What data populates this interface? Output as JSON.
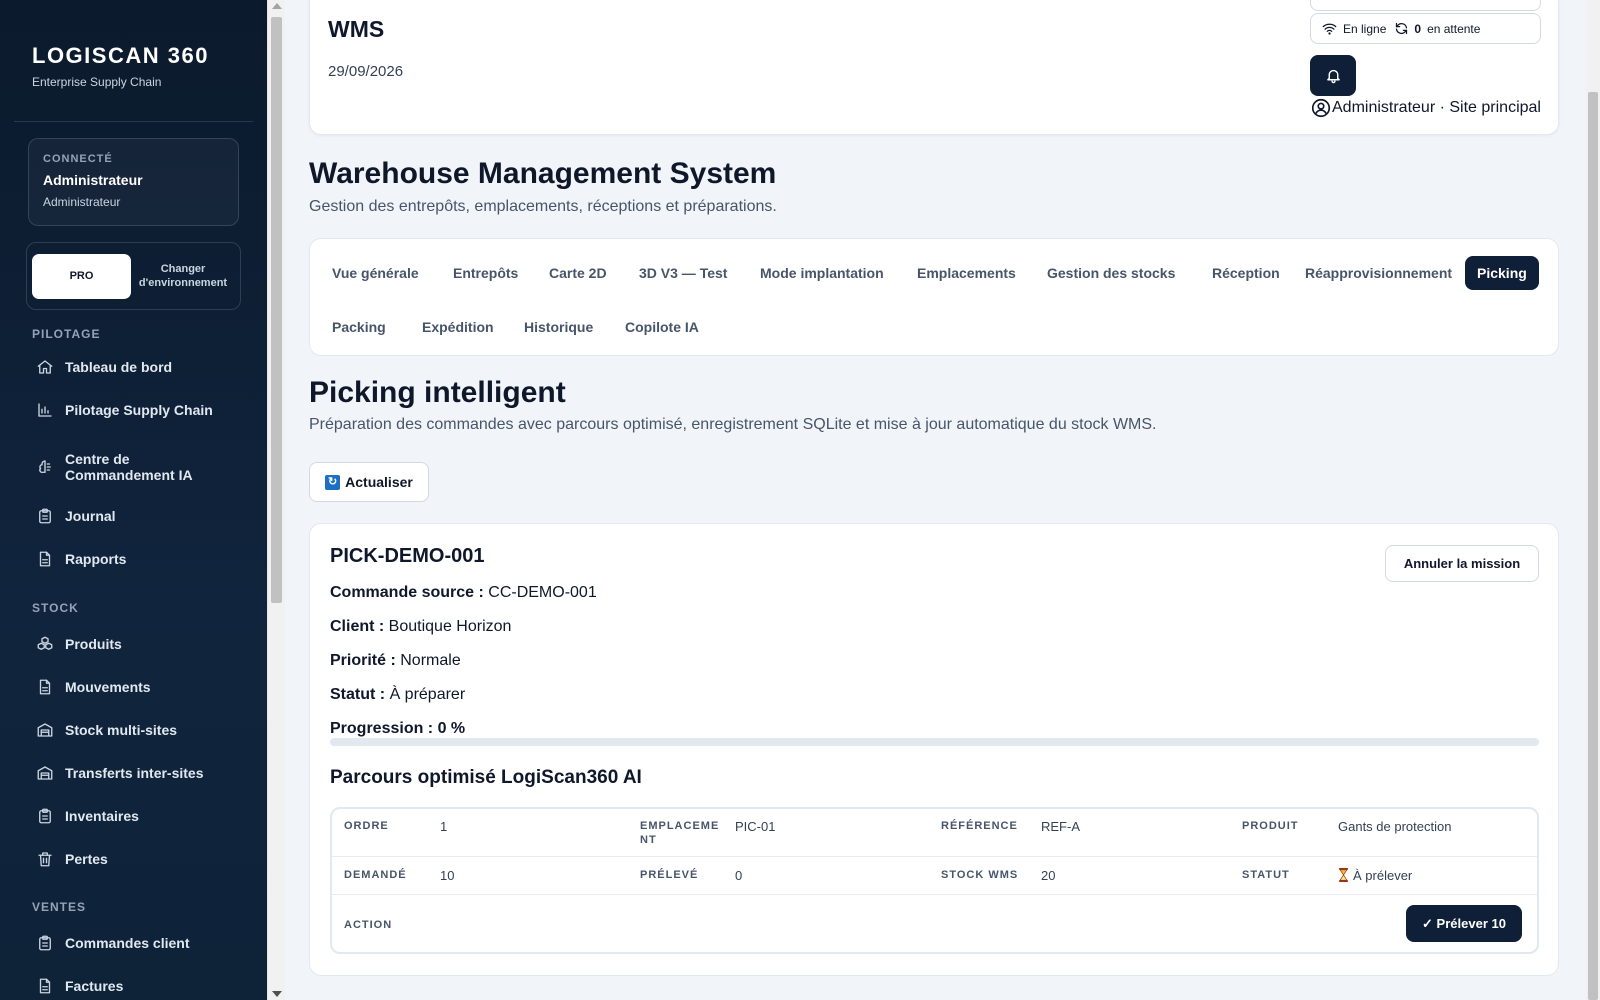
{
  "brand": {
    "title": "LOGISCAN 360",
    "subtitle": "Enterprise Supply Chain"
  },
  "user_card": {
    "label": "CONNECTÉ",
    "name": "Administrateur",
    "role": "Administrateur"
  },
  "environment": {
    "current": "PRO",
    "change_label_1": "Changer",
    "change_label_2": "d'environnement"
  },
  "nav": {
    "sections": [
      "PILOTAGE",
      "STOCK",
      "VENTES"
    ],
    "pilotage": [
      {
        "label": "Tableau de bord",
        "icon": "home-icon"
      },
      {
        "label": "Pilotage Supply Chain",
        "icon": "bar-chart-icon"
      },
      {
        "label": "Centre de Commandement IA",
        "icon": "brain-icon"
      },
      {
        "label": "Journal",
        "icon": "clipboard-icon"
      },
      {
        "label": "Rapports",
        "icon": "document-icon"
      }
    ],
    "stock": [
      {
        "label": "Produits",
        "icon": "boxes-icon"
      },
      {
        "label": "Mouvements",
        "icon": "document-icon"
      },
      {
        "label": "Stock multi-sites",
        "icon": "warehouse-icon"
      },
      {
        "label": "Transferts inter-sites",
        "icon": "warehouse-icon"
      },
      {
        "label": "Inventaires",
        "icon": "clipboard-icon"
      },
      {
        "label": "Pertes",
        "icon": "trash-icon"
      }
    ],
    "ventes": [
      {
        "label": "Commandes client",
        "icon": "clipboard-icon"
      },
      {
        "label": "Factures",
        "icon": "document-icon"
      }
    ]
  },
  "header": {
    "title": "WMS",
    "date": "29/09/2026",
    "status_online": "En ligne",
    "pending_count": "0",
    "pending_label": "en attente",
    "user_label": "Administrateur · Site principal"
  },
  "page": {
    "title": "Warehouse Management System",
    "subtitle": "Gestion des entrepôts, emplacements, réceptions et préparations."
  },
  "tabs": [
    "Vue générale",
    "Entrepôts",
    "Carte 2D",
    "3D V3 — Test",
    "Mode implantation",
    "Emplacements",
    "Gestion des stocks",
    "Réception",
    "Réapprovisionnement",
    "Picking",
    "Packing",
    "Expédition",
    "Historique",
    "Copilote IA"
  ],
  "active_tab": "Picking",
  "section": {
    "title": "Picking intelligent",
    "subtitle": "Préparation des commandes avec parcours optimisé, enregistrement SQLite et mise à jour automatique du stock WMS.",
    "refresh_label": "Actualiser"
  },
  "mission": {
    "id": "PICK-DEMO-001",
    "cancel_label": "Annuler la mission",
    "source_label": "Commande source :",
    "source_value": "CC-DEMO-001",
    "client_label": "Client :",
    "client_value": "Boutique Horizon",
    "priority_label": "Priorité :",
    "priority_value": "Normale",
    "status_label": "Statut :",
    "status_value": "À préparer",
    "progress_label": "Progression : 0 %",
    "progress": 0,
    "route_title": "Parcours optimisé LogiScan360 AI"
  },
  "route_table": {
    "keys": {
      "ordre": "ORDRE",
      "emplacement_1": "EMPLACEME",
      "emplacement_2": "NT",
      "reference": "RÉFÉRENCE",
      "produit": "PRODUIT",
      "demande": "DEMANDÉ",
      "preleve": "PRÉLEVÉ",
      "stock_wms": "STOCK WMS",
      "statut": "STATUT",
      "action": "ACTION"
    },
    "row": {
      "ordre": "1",
      "emplacement": "PIC-01",
      "reference": "REF-A",
      "produit": "Gants de protection",
      "demande": "10",
      "preleve": "0",
      "stock_wms": "20",
      "statut": "À prélever",
      "action_label": "✓ Prélever 10"
    }
  },
  "colors": {
    "primary": "#0f1f38",
    "sidebar": "#0b1a2c",
    "accent_refresh": "#1d6fc4"
  }
}
